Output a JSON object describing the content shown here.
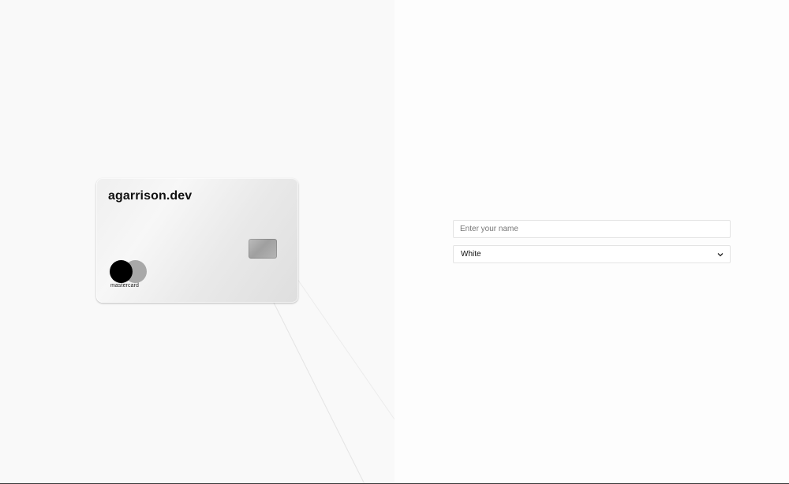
{
  "card": {
    "brand": "agarrison.dev",
    "network": "mastercard",
    "color": "White",
    "colors": {
      "face": "#efefef",
      "chip": "#b0b0b0",
      "network_dark": "#000000",
      "network_light": "#a8a8a8"
    }
  },
  "form": {
    "name_placeholder": "Enter your name",
    "name_value": "",
    "color_select_value": "White"
  },
  "icons": {
    "select_arrow": "chevron-down-icon"
  }
}
